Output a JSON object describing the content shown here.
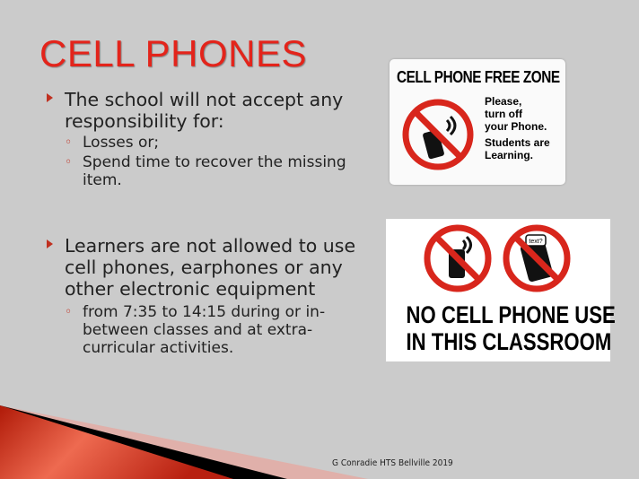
{
  "title": "CELL PHONES",
  "bullets": [
    {
      "text": "The school will not accept any responsibility for:",
      "subs": [
        "Losses or;",
        "Spend time to recover the missing item."
      ]
    },
    {
      "text": "Learners are not allowed to use cell phones, earphones or any other electronic equipment",
      "subs": [
        "from 7:35 to 14:15 during or in-between classes and at extra-curricular activities."
      ]
    }
  ],
  "sign1": {
    "heading": "CELL PHONE FREE ZONE",
    "line1": "Please,",
    "line2": "turn off",
    "line3": "your Phone.",
    "line4": "Students are",
    "line5": "Learning."
  },
  "sign2": {
    "line1": "NO CELL PHONE USE",
    "line2": "IN THIS CLASSROOM",
    "bubble": "text?"
  },
  "footer": "G Conradie HTS Bellville 2019",
  "colors": {
    "accent": "#e3241b",
    "background": "#cbcbcb"
  }
}
